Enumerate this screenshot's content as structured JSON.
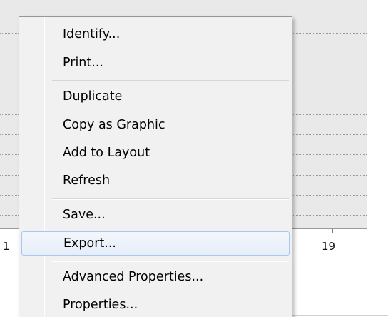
{
  "axis": {
    "tick_labels": [
      "1",
      "19"
    ]
  },
  "context_menu": {
    "items": [
      {
        "label": "Identify...",
        "highlighted": false
      },
      {
        "label": "Print...",
        "highlighted": false
      },
      {
        "label": "Duplicate",
        "highlighted": false
      },
      {
        "label": "Copy as Graphic",
        "highlighted": false
      },
      {
        "label": "Add to Layout",
        "highlighted": false
      },
      {
        "label": "Refresh",
        "highlighted": false
      },
      {
        "label": "Save...",
        "highlighted": false
      },
      {
        "label": "Export...",
        "highlighted": true
      },
      {
        "label": "Advanced Properties...",
        "highlighted": false
      },
      {
        "label": "Properties...",
        "highlighted": false
      }
    ]
  },
  "colors": {
    "plot_background": "#e9e9e9",
    "menu_background": "#f1f1f1",
    "highlight_border": "#a8c6ee"
  }
}
